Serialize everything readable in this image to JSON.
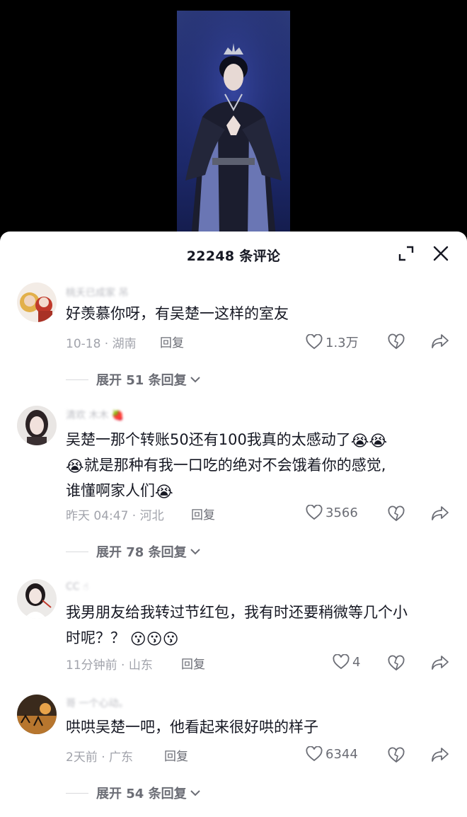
{
  "panel": {
    "title": "22248 条评论"
  },
  "comments": [
    {
      "username": "桃夭已成家 吊",
      "text": "好羡慕你呀，有吴楚一这样的室友",
      "meta": "10-18 · 湖南",
      "reply": "回复",
      "likes": "1.3万",
      "expand": "展开 51 条回复"
    },
    {
      "username": "清欢 木木 🍓",
      "text_lines": [
        "吴楚一那个转账50还有100我真的太感动了",
        "就是那种有我一口吃的绝对不会饿着你的感觉,",
        "谁懂啊家人们"
      ],
      "meta": "昨天 04:47 · 河北",
      "reply": "回复",
      "likes": "3566",
      "expand": "展开 78 条回复"
    },
    {
      "username": "CC ☝",
      "text_lines": [
        "我男朋友给我转过节红包，我有时还要稍微等几个小",
        "时呢？？"
      ],
      "meta": "11分钟前 · 山东",
      "reply": "回复",
      "likes": "4"
    },
    {
      "username": "哥 一个心动。",
      "text": "哄哄吴楚一吧，他看起来很好哄的样子",
      "meta": "2天前 · 广东",
      "reply": "回复",
      "likes": "6344",
      "expand": "展开 54 条回复"
    }
  ],
  "emoji": {
    "cry": "😭",
    "pout": "😗"
  },
  "colors": {
    "accent_text": "#161823",
    "meta": "#a1a3ab",
    "video_bg": "#1c2868"
  }
}
